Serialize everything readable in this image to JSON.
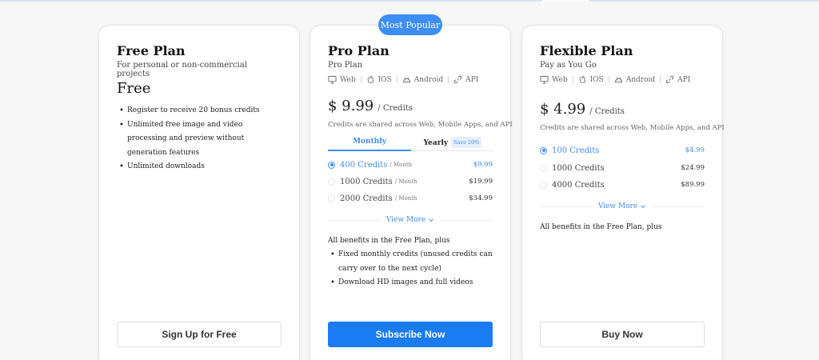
{
  "badge": "Most Popular",
  "free": {
    "title": "Free Plan",
    "subtitle": "For personal or non-commercial projects",
    "price": "Free",
    "benefits": [
      "Register to receive 20 bonus credits",
      "Unlimited free image and video processing and preview without generation features",
      "Unlimited downloads"
    ],
    "cta": "Sign Up for Free"
  },
  "pro": {
    "title": "Pro Plan",
    "subtitle": "Pro Plan",
    "platforms": [
      "Web",
      "IOS",
      "Android",
      "API"
    ],
    "price": "$ 9.99",
    "price_unit": "/ Credits",
    "shared_note": "Credits are shared across Web, Mobile Apps, and API",
    "tabs": {
      "monthly": "Monthly",
      "yearly": "Yearly",
      "save": "Save 20%"
    },
    "options": [
      {
        "credits": "400 Credits",
        "period": "/ Month",
        "price": "$9.99",
        "selected": true
      },
      {
        "credits": "1000 Credits",
        "period": "/ Month",
        "price": "$19.99",
        "selected": false
      },
      {
        "credits": "2000 Credits",
        "period": "/ Month",
        "price": "$34.99",
        "selected": false
      }
    ],
    "view_more": "View More",
    "benefits_head": "All benefits in the Free Plan, plus",
    "benefits": [
      "Fixed monthly credits (unused credits can carry over to the next cycle)",
      "Download HD images and full videos"
    ],
    "cta": "Subscribe Now"
  },
  "flex": {
    "title": "Flexible Plan",
    "subtitle": "Pay as You Go",
    "platforms": [
      "Web",
      "IOS",
      "Android",
      "API"
    ],
    "price": "$ 4.99",
    "price_unit": "/ Credits",
    "shared_note": "Credits are shared across Web, Mobile Apps, and API",
    "options": [
      {
        "credits": "100 Credits",
        "price": "$4.99",
        "selected": true
      },
      {
        "credits": "1000 Credits",
        "price": "$24.99",
        "selected": false
      },
      {
        "credits": "4000 Credits",
        "price": "$89.99",
        "selected": false
      }
    ],
    "view_more": "View More",
    "benefits_head": "All benefits in the Free Plan, plus",
    "cta": "Buy Now"
  },
  "icons": {
    "web": "monitor-icon",
    "ios": "apple-icon",
    "android": "android-icon",
    "api": "link-icon",
    "view_more": "chevron-down-icon"
  },
  "colors": {
    "accent": "#3d8ef6",
    "primary_button": "#1a7cf5"
  }
}
